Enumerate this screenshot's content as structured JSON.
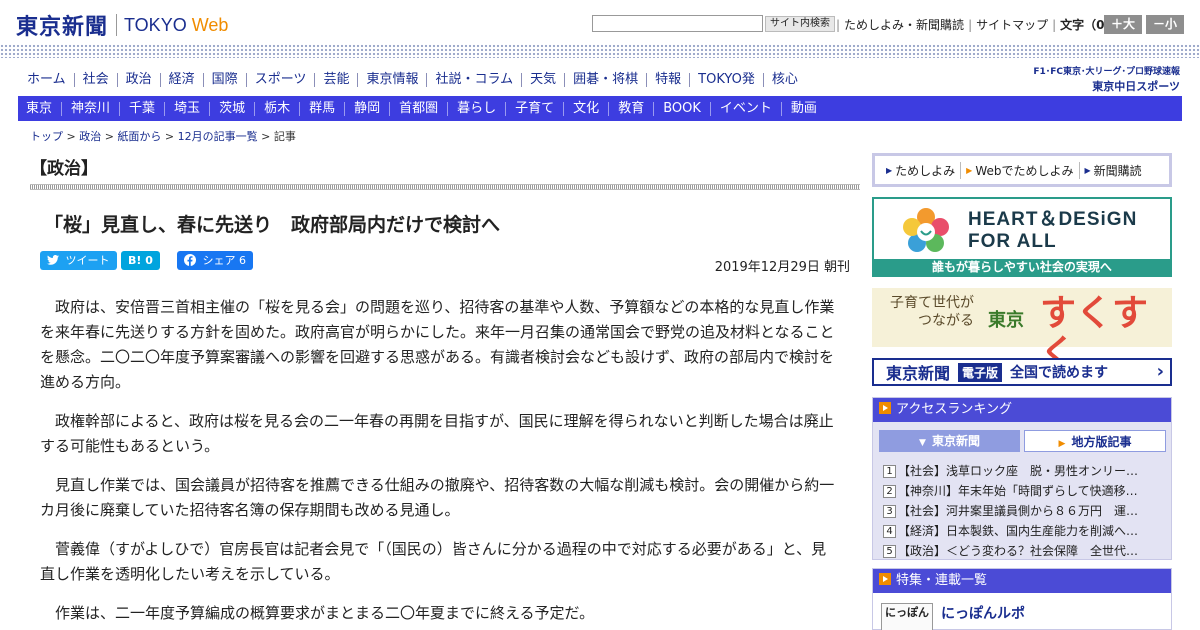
{
  "header": {
    "logo_kanji": "東京新聞",
    "logo_tokyo": "TOKYO",
    "logo_web": "Web",
    "search_button": "サイト内検索",
    "links": [
      "ためしよみ・新聞購読",
      "サイトマップ"
    ],
    "font_size_label": "文字（0）",
    "font_bigger": "＋大",
    "font_smaller": "－小"
  },
  "nav_main": [
    "ホーム",
    "社会",
    "政治",
    "経済",
    "国際",
    "スポーツ",
    "芸能",
    "東京情報",
    "社説・コラム",
    "天気",
    "囲碁・将棋",
    "特報",
    "TOKYO発",
    "核心"
  ],
  "chunichi": {
    "line1": "F1･FC東京･大リーグ･プロ野球速報",
    "line2": "東京中日スポーツ"
  },
  "nav_region": [
    "東京",
    "神奈川",
    "千葉",
    "埼玉",
    "茨城",
    "栃木",
    "群馬",
    "静岡",
    "首都圏",
    "暮らし",
    "子育て",
    "文化",
    "教育",
    "BOOK",
    "イベント",
    "動画"
  ],
  "breadcrumb": {
    "items": [
      "トップ",
      "政治",
      "紙面から",
      "12月の記事一覧"
    ],
    "current": "記事",
    "sep": " > "
  },
  "article": {
    "section": "【政治】",
    "headline": "「桜」見直し、春に先送り　政府部局内だけで検討へ",
    "tweet": "ツイート",
    "hatebu": "B! 0",
    "share": "シェア 6",
    "date": "2019年12月29日 朝刊",
    "paragraphs": [
      "政府は、安倍晋三首相主催の「桜を見る会」の問題を巡り、招待客の基準や人数、予算額などの本格的な見直し作業を来年春に先送りする方針を固めた。政府高官が明らかにした。来年一月召集の通常国会で野党の追及材料となることを懸念。二〇二〇年度予算案審議への影響を回避する思惑がある。有識者検討会なども設けず、政府の部局内で検討を進める方向。",
      "政権幹部によると、政府は桜を見る会の二一年春の再開を目指すが、国民に理解を得られないと判断した場合は廃止する可能性もあるという。",
      "見直し作業では、国会議員が招待客を推薦できる仕組みの撤廃や、招待客数の大幅な削減も検討。会の開催から約一カ月後に廃棄していた招待客名簿の保存期間も改める見通し。",
      "菅義偉（すがよしひで）官房長官は記者会見で「（国民の）皆さんに分かる過程の中で対応する必要がある」と、見直し作業を透明化したい考えを示している。",
      "作業は、二一年度予算編成の概算要求がまとまる二〇年夏までに終える予定だ。"
    ]
  },
  "sidebar": {
    "tameshi": [
      "ためしよみ",
      "Webでためしよみ",
      "新聞購読"
    ],
    "heart_design": {
      "title_1": "HEART＆DESiGN",
      "title_2": "FOR ALL",
      "bar": "誰もが暮らしやすい社会の実現へ"
    },
    "sukusuku": {
      "line1": "子育て世代が",
      "line2": "つながる",
      "tokyo": "東京",
      "suku": "すくすく"
    },
    "epaper": {
      "kanji": "東京新聞",
      "badge": "電子版",
      "text": "全国で読めます"
    },
    "ranking": {
      "title": "アクセスランキング",
      "tab_a": "東京新聞",
      "tab_b": "地方版記事",
      "items": [
        {
          "n": "1",
          "text": "【社会】浅草ロック座　脱・男性オンリー…"
        },
        {
          "n": "2",
          "text": "【神奈川】年末年始「時間ずらして快適移…"
        },
        {
          "n": "3",
          "text": "【社会】河井案里議員側から８６万円　運…"
        },
        {
          "n": "4",
          "text": "【経済】日本製鉄、国内生産能力を削減へ…"
        },
        {
          "n": "5",
          "text": "【政治】＜どう変わる？社会保障　全世代…"
        }
      ]
    },
    "features": {
      "title": "特集・連載一覧",
      "thumb": "にっぽん",
      "item": "にっぽんルポ"
    }
  },
  "colors": {
    "brand_navy": "#1a2e8f",
    "accent_orange": "#f08c00",
    "nav_blue": "#3d3de0",
    "teal": "#2a9c8a"
  }
}
